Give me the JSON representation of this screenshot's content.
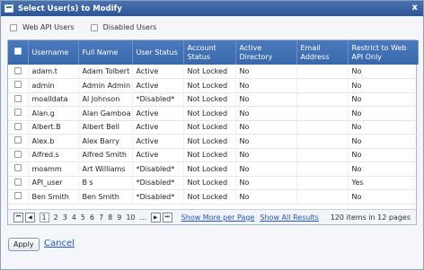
{
  "window": {
    "title": "Select User(s) to Modify",
    "close_glyph": "x"
  },
  "filters": [
    {
      "label": "Web API Users",
      "checked": false
    },
    {
      "label": "Disabled Users",
      "checked": false
    }
  ],
  "table": {
    "columns": [
      "",
      "Username",
      "Full Name",
      "User Status",
      "Account Status",
      "Active Directory",
      "Email Address",
      "Restrict to Web API Only"
    ],
    "rows": [
      [
        "adam.t",
        "Adam Tolbert",
        "Active",
        "Not Locked",
        "No",
        "",
        "No"
      ],
      [
        "admin",
        "Admin Admin",
        "Active",
        "Not Locked",
        "No",
        "",
        "No"
      ],
      [
        "moalldata",
        "Al Johnson",
        "*Disabled*",
        "Not Locked",
        "No",
        "",
        "No"
      ],
      [
        "Alan.g",
        "Alan Gamboa",
        "Active",
        "Not Locked",
        "No",
        "",
        "No"
      ],
      [
        "Albert.B",
        "Albert Bell",
        "Active",
        "Not Locked",
        "No",
        "",
        "No"
      ],
      [
        "Alex.b",
        "Alex Barry",
        "Active",
        "Not Locked",
        "No",
        "",
        "No"
      ],
      [
        "Alfred.s",
        "Alfred Smith",
        "Active",
        "Not Locked",
        "No",
        "",
        "No"
      ],
      [
        "moamm",
        "Art Williams",
        "*Disabled*",
        "Not Locked",
        "No",
        "",
        "No"
      ],
      [
        "API_user",
        "B s",
        "*Disabled*",
        "Not Locked",
        "No",
        "",
        "Yes"
      ],
      [
        "Ben Smith",
        "Ben Smith",
        "*Disabled*",
        "Not Locked",
        "No",
        "",
        "No"
      ]
    ]
  },
  "pager": {
    "first": "⏮",
    "prev": "◀",
    "next": "▶",
    "last": "⏭",
    "pages": [
      "1",
      "2",
      "3",
      "4",
      "5",
      "6",
      "7",
      "8",
      "9",
      "10",
      "..."
    ],
    "current_page": "1",
    "show_more": "Show More per Page",
    "show_all": "Show All Results",
    "info": "120 items in 12 pages"
  },
  "actions": {
    "apply": "Apply",
    "cancel": "Cancel"
  },
  "colors": {
    "header": "#3968ab",
    "titlebar": "#2b5596",
    "link": "#1f55c6"
  }
}
